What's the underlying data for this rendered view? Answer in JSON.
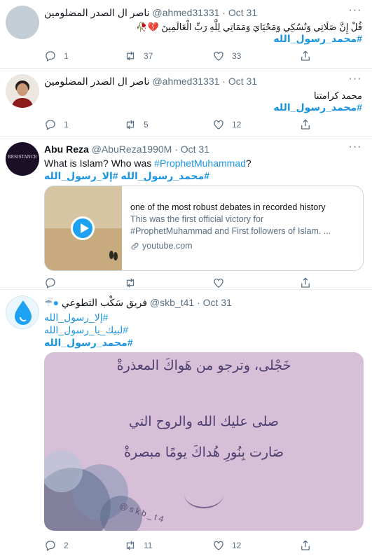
{
  "tweets": [
    {
      "name": "ناصر ال الصدر المضلومين",
      "handle": "@ahmed31331",
      "dot": "·",
      "time": "Oct 31",
      "text": "قُلْ إِنَّ صَلَاتِي وَنُسُكِي وَمَحْيَايَ وَمَمَاتِي لِلَّهِ رَبِّ الْعَالَمِينَ 💔🥀",
      "hashtag": "#محمد_رسول_الله",
      "replies": "1",
      "retweets": "37",
      "likes": "33"
    },
    {
      "name": "ناصر ال الصدر المضلومين",
      "handle": "@ahmed31331",
      "dot": "·",
      "time": "Oct 31",
      "text": "محمد كرامتنا",
      "hashtag": "#محمد_رسول_الله",
      "replies": "1",
      "retweets": "5",
      "likes": "12"
    },
    {
      "name": "Abu Reza",
      "handle": "@AbuReza1990M",
      "dot": "·",
      "time": "Oct 31",
      "text_prefix": "What is Islam? Who was ",
      "text_link": "#ProphetMuhammad",
      "text_suffix": "?",
      "hashtags_rtl": "#محمد_رسول_الله #إلا_رسول_الله",
      "avatar_text": "RESISTANCE",
      "card": {
        "title": "one of the most robust debates in recorded history",
        "desc1": "This was the first official victory for",
        "desc2": "#ProphetMuhammad and First followers of Islam. ...",
        "domain": "youtube.com"
      }
    },
    {
      "name": "فريق سَكْب التطوعي",
      "handle": "@skb_t41",
      "dot": "·",
      "time": "Oct 31",
      "line1": "#إلا_رسول_الله",
      "line2": "#لبيك_يا_رسول_الله",
      "line3": "#محمد_رسول_الله",
      "poster": {
        "line1": "خَجْلى، وترجو من هَواكَ المعذرةْ",
        "line2": "صلى عليك الله والروح التي",
        "line3": "صَارت بِنُورِ هُداكَ يومًا مبصرةْ",
        "watermark": "@skb_t4"
      },
      "replies": "2",
      "retweets": "11",
      "likes": "12"
    }
  ],
  "colors": {
    "link": "#1b95e0",
    "muted": "#5b7083",
    "border": "#e6ecf0"
  }
}
